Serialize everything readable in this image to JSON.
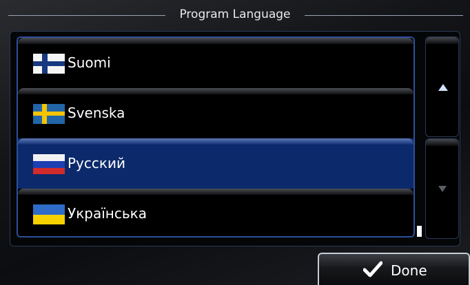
{
  "header": {
    "title": "Program Language"
  },
  "languages": [
    {
      "label": "Suomi",
      "flag": "finland-flag-icon",
      "selected": false
    },
    {
      "label": "Svenska",
      "flag": "sweden-flag-icon",
      "selected": false
    },
    {
      "label": "Русский",
      "flag": "russia-flag-icon",
      "selected": true
    },
    {
      "label": "Українська",
      "flag": "ukraine-flag-icon",
      "selected": false
    }
  ],
  "scroll": {
    "up_icon": "triangle-up-icon",
    "down_icon": "triangle-down-icon"
  },
  "footer": {
    "done_label": "Done",
    "done_icon": "checkmark-icon"
  },
  "colors": {
    "selected_row": "#0c2a6b",
    "list_border": "#2d4f9c",
    "up_arrow": "#cfe3ff",
    "down_arrow_disabled": "#5a5e66"
  }
}
